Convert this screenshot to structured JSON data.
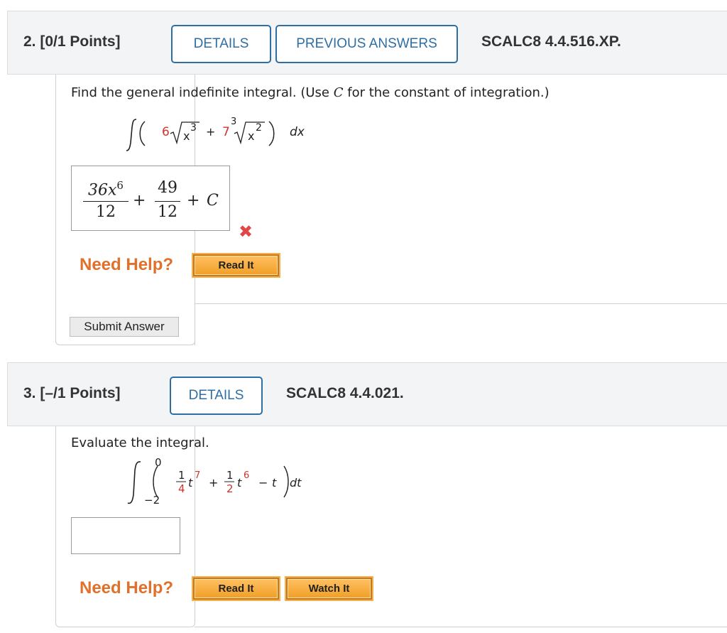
{
  "q2": {
    "number": "2.",
    "points": "[0/1 Points]",
    "details_label": "DETAILS",
    "previous_answers_label": "PREVIOUS ANSWERS",
    "code": "SCALC8 4.4.516.XP.",
    "prompt_pre": "Find the general indefinite integral. (Use ",
    "prompt_var": "C",
    "prompt_post": " for the constant of integration.)",
    "integral": {
      "coef1": "6",
      "radicand1": "x",
      "exp1": "3",
      "plus": "+",
      "coef2": "7",
      "root_index2": "3",
      "radicand2": "x",
      "exp2": "2",
      "dx": "dx"
    },
    "answer": {
      "num1": "36x",
      "num1_exp": "6",
      "den1": "12",
      "plus1": "+",
      "num2": "49",
      "den2": "12",
      "plus2": "+",
      "const": "C"
    },
    "result_mark": "✖",
    "need_help": "Need Help?",
    "read_it": "Read It",
    "submit": "Submit Answer"
  },
  "q3": {
    "number": "3.",
    "points": "[–/1 Points]",
    "details_label": "DETAILS",
    "code": "SCALC8 4.4.021.",
    "prompt": "Evaluate the integral.",
    "integral": {
      "upper": "0",
      "lower": "−2",
      "f1_num": "1",
      "f1_den": "4",
      "t1": "t",
      "e1": "7",
      "plus": "+",
      "f2_num": "1",
      "f2_den": "2",
      "t2": "t",
      "e2": "6",
      "minus": "−",
      "t3": "t",
      "dt": "dt"
    },
    "answer_value": "",
    "need_help": "Need Help?",
    "read_it": "Read It",
    "watch_it": "Watch It"
  },
  "colors": {
    "accent_blue": "#2d6ea5",
    "header_bg": "#f3f4f5",
    "help_orange": "#e0702a",
    "red_coef": "#d0332b",
    "wrong_mark": "#e24646"
  }
}
